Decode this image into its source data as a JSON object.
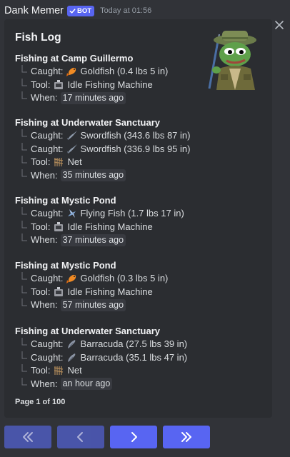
{
  "message": {
    "author": "Dank Memer",
    "bot_badge": "BOT",
    "timestamp": "Today at 01:56"
  },
  "embed": {
    "title": "Fish Log",
    "footer": "Page 1 of 100",
    "thumbnail_icon": "pepe-fisherman-icon",
    "sections": [
      {
        "title": "Fishing at Camp Guillermo",
        "lines": [
          {
            "label": "Caught:",
            "icon": "goldfish-icon",
            "text": "Goldfish (0.4 lbs 5 in)"
          },
          {
            "label": "Tool:",
            "icon": "idle-fishing-machine-icon",
            "text": "Idle Fishing Machine"
          },
          {
            "label": "When:",
            "code": "17 minutes ago"
          }
        ]
      },
      {
        "title": "Fishing at Underwater Sanctuary",
        "lines": [
          {
            "label": "Caught:",
            "icon": "swordfish-icon",
            "text": "Swordfish (343.6 lbs 87 in)"
          },
          {
            "label": "Caught:",
            "icon": "swordfish-icon",
            "text": "Swordfish (336.9 lbs 95 in)"
          },
          {
            "label": "Tool:",
            "icon": "net-icon",
            "text": "Net"
          },
          {
            "label": "When:",
            "code": "35 minutes ago"
          }
        ]
      },
      {
        "title": "Fishing at Mystic Pond",
        "lines": [
          {
            "label": "Caught:",
            "icon": "flying-fish-icon",
            "text": "Flying Fish (1.7 lbs 17 in)"
          },
          {
            "label": "Tool:",
            "icon": "idle-fishing-machine-icon",
            "text": "Idle Fishing Machine"
          },
          {
            "label": "When:",
            "code": "37 minutes ago"
          }
        ]
      },
      {
        "title": "Fishing at Mystic Pond",
        "lines": [
          {
            "label": "Caught:",
            "icon": "goldfish-icon",
            "text": "Goldfish (0.3 lbs 5 in)"
          },
          {
            "label": "Tool:",
            "icon": "idle-fishing-machine-icon",
            "text": "Idle Fishing Machine"
          },
          {
            "label": "When:",
            "code": "57 minutes ago"
          }
        ]
      },
      {
        "title": "Fishing at Underwater Sanctuary",
        "lines": [
          {
            "label": "Caught:",
            "icon": "barracuda-icon",
            "text": "Barracuda (27.5 lbs 39 in)"
          },
          {
            "label": "Caught:",
            "icon": "barracuda-icon",
            "text": "Barracuda (35.1 lbs 47 in)"
          },
          {
            "label": "Tool:",
            "icon": "net-icon",
            "text": "Net"
          },
          {
            "label": "When:",
            "code": "an hour ago"
          }
        ]
      }
    ]
  },
  "buttons": [
    {
      "icon": "double-chevron-left-icon",
      "disabled": true
    },
    {
      "icon": "chevron-left-icon",
      "disabled": true
    },
    {
      "icon": "chevron-right-icon",
      "disabled": false
    },
    {
      "icon": "double-chevron-right-icon",
      "disabled": false
    }
  ],
  "colors": {
    "background": "#313338",
    "embed": "#2b2d31",
    "blurple": "#5865f2"
  }
}
